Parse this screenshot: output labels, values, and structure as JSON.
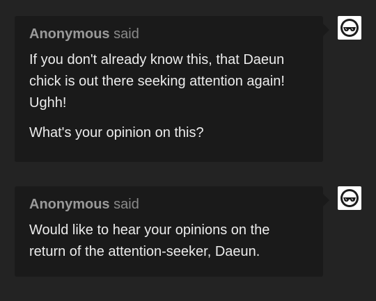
{
  "asks": [
    {
      "asker_name": "Anonymous",
      "asker_suffix": "said",
      "paragraphs": [
        "If you don't already know this, that Daeun chick is out there seeking attention again! Ughh!",
        "What's your opinion on this?"
      ],
      "avatar_icon": "anonymous-sunglasses-icon"
    },
    {
      "asker_name": "Anonymous",
      "asker_suffix": "said",
      "paragraphs": [
        "Would like to hear your opinions on the return of the attention-seeker, Daeun."
      ],
      "avatar_icon": "anonymous-sunglasses-icon"
    }
  ],
  "colors": {
    "background": "#232323",
    "bubble": "#1a1a1a",
    "text": "#ececec",
    "muted": "#9a9a9a"
  }
}
